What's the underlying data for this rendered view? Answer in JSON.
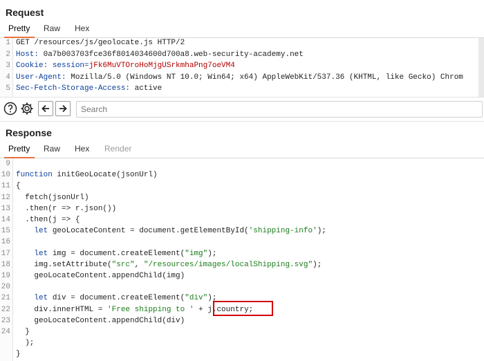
{
  "request": {
    "title": "Request",
    "tabs": [
      "Pretty",
      "Raw",
      "Hex"
    ],
    "lines": [
      {
        "n": "1",
        "parts": [
          {
            "t": "GET /resources/js/geolocate.js HTTP/2",
            "c": ""
          }
        ]
      },
      {
        "n": "2",
        "parts": [
          {
            "t": "Host: ",
            "c": "k-blue"
          },
          {
            "t": "0a7b003703fce36f8014034600d700a8.web-security-academy.net",
            "c": ""
          }
        ]
      },
      {
        "n": "3",
        "parts": [
          {
            "t": "Cookie: ",
            "c": "k-blue"
          },
          {
            "t": "session=",
            "c": "k-blue"
          },
          {
            "t": "jFk6MuVTOroHoMjgUSrkmhaPng7oeVM4",
            "c": "k-red"
          }
        ]
      },
      {
        "n": "4",
        "parts": [
          {
            "t": "User-Agent: ",
            "c": "k-blue"
          },
          {
            "t": "Mozilla/5.0 (Windows NT 10.0; Win64; x64) AppleWebKit/537.36 (KHTML, like Gecko) Chrom",
            "c": ""
          }
        ]
      },
      {
        "n": "5",
        "parts": [
          {
            "t": "Sec-Fetch-Storage-Access: ",
            "c": "k-blue"
          },
          {
            "t": "active",
            "c": ""
          }
        ]
      }
    ]
  },
  "toolbar": {
    "search_placeholder": "Search",
    "icons": [
      "help-icon",
      "gear-icon",
      "arrow-left-icon",
      "arrow-right-icon"
    ]
  },
  "response": {
    "title": "Response",
    "tabs": [
      "Pretty",
      "Raw",
      "Hex",
      "Render"
    ],
    "lines": [
      {
        "n": "9",
        "parts": [
          {
            "t": "",
            "c": ""
          }
        ]
      },
      {
        "n": "10",
        "parts": [
          {
            "t": "function ",
            "c": "k-blue"
          },
          {
            "t": "initGeoLocate(jsonUrl)",
            "c": ""
          }
        ]
      },
      {
        "n": "11",
        "parts": [
          {
            "t": "{",
            "c": ""
          }
        ]
      },
      {
        "n": "12",
        "parts": [
          {
            "t": "  fetch(jsonUrl)",
            "c": ""
          }
        ]
      },
      {
        "n": "13",
        "parts": [
          {
            "t": "  .then(r => r.json())",
            "c": ""
          }
        ]
      },
      {
        "n": "14",
        "parts": [
          {
            "t": "  .then(j => {",
            "c": ""
          }
        ]
      },
      {
        "n": "15",
        "parts": [
          {
            "t": "    ",
            "c": ""
          },
          {
            "t": "let ",
            "c": "k-blue"
          },
          {
            "t": "geoLocateContent = document.getElementById(",
            "c": ""
          },
          {
            "t": "'shipping-info'",
            "c": "k-green"
          },
          {
            "t": ");",
            "c": ""
          }
        ]
      },
      {
        "n": "16",
        "parts": [
          {
            "t": "",
            "c": ""
          }
        ]
      },
      {
        "n": "17",
        "parts": [
          {
            "t": "    ",
            "c": ""
          },
          {
            "t": "let ",
            "c": "k-blue"
          },
          {
            "t": "img = document.createElement(",
            "c": ""
          },
          {
            "t": "\"img\"",
            "c": "k-green"
          },
          {
            "t": ");",
            "c": ""
          }
        ]
      },
      {
        "n": "18",
        "parts": [
          {
            "t": "    img.setAttribute(",
            "c": ""
          },
          {
            "t": "\"src\"",
            "c": "k-green"
          },
          {
            "t": ", ",
            "c": ""
          },
          {
            "t": "\"/resources/images/localShipping.svg\"",
            "c": "k-green"
          },
          {
            "t": ");",
            "c": ""
          }
        ]
      },
      {
        "n": "19",
        "parts": [
          {
            "t": "    geoLocateContent.appendChild(img)",
            "c": ""
          }
        ]
      },
      {
        "n": "20",
        "parts": [
          {
            "t": "",
            "c": ""
          }
        ]
      },
      {
        "n": "21",
        "parts": [
          {
            "t": "    ",
            "c": ""
          },
          {
            "t": "let ",
            "c": "k-blue"
          },
          {
            "t": "div = document.createElement(",
            "c": ""
          },
          {
            "t": "\"div\"",
            "c": "k-green"
          },
          {
            "t": ");",
            "c": ""
          }
        ]
      },
      {
        "n": "22",
        "parts": [
          {
            "t": "    div.innerHTML = ",
            "c": ""
          },
          {
            "t": "'Free shipping to '",
            "c": "k-green"
          },
          {
            "t": " + j.country;",
            "c": ""
          }
        ]
      },
      {
        "n": "23",
        "parts": [
          {
            "t": "    geoLocateContent.appendChild(div)",
            "c": ""
          }
        ]
      },
      {
        "n": "24",
        "parts": [
          {
            "t": "  }",
            "c": ""
          }
        ]
      },
      {
        "n": "",
        "parts": [
          {
            "t": "  );",
            "c": ""
          }
        ]
      },
      {
        "n": "",
        "parts": [
          {
            "t": "}",
            "c": ""
          }
        ]
      }
    ]
  },
  "colors": {
    "accent": "#e8703a",
    "highlight_box": "#d20000"
  }
}
